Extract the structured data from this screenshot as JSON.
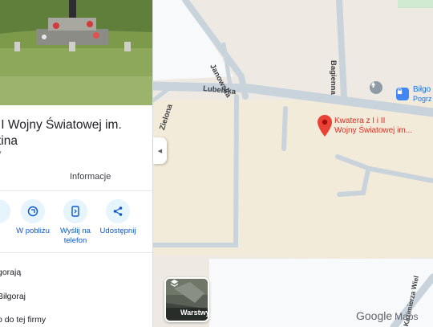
{
  "panel": {
    "title_line1": "II Wojny Światowej im.",
    "title_line2": "tina",
    "subtitle": "y",
    "tab_info": "Informacje",
    "actions": [
      {
        "label1": "W pobliżu",
        "label2": "",
        "icon": "nearby-icon"
      },
      {
        "label1": "Wyślij na",
        "label2": "telefon",
        "icon": "send-to-phone-icon"
      },
      {
        "label1": "Udostępnij",
        "label2": "",
        "icon": "share-icon"
      }
    ],
    "rows": [
      "gorają",
      "Biłgoraj",
      "o do tej firmy"
    ]
  },
  "map": {
    "streets": {
      "lubelska": "Lubelska",
      "janowska": "Janowska",
      "bagienna": "Bagienna",
      "zielona": "Zielona",
      "wiel": "Kazimierza Wiel"
    },
    "marker_line1": "Kwatera z I i II",
    "marker_line2": "Wojny Światowej im...",
    "poi_line1": "Biłgo",
    "poi_line2": "Pogrz",
    "layers_label": "Warstwy",
    "google": "Google",
    "maps": "Maps"
  },
  "colors": {
    "marker": "#ea4335",
    "accent": "#0b57d0",
    "road": "#c9d3dc",
    "block": "#f3ebd9"
  }
}
